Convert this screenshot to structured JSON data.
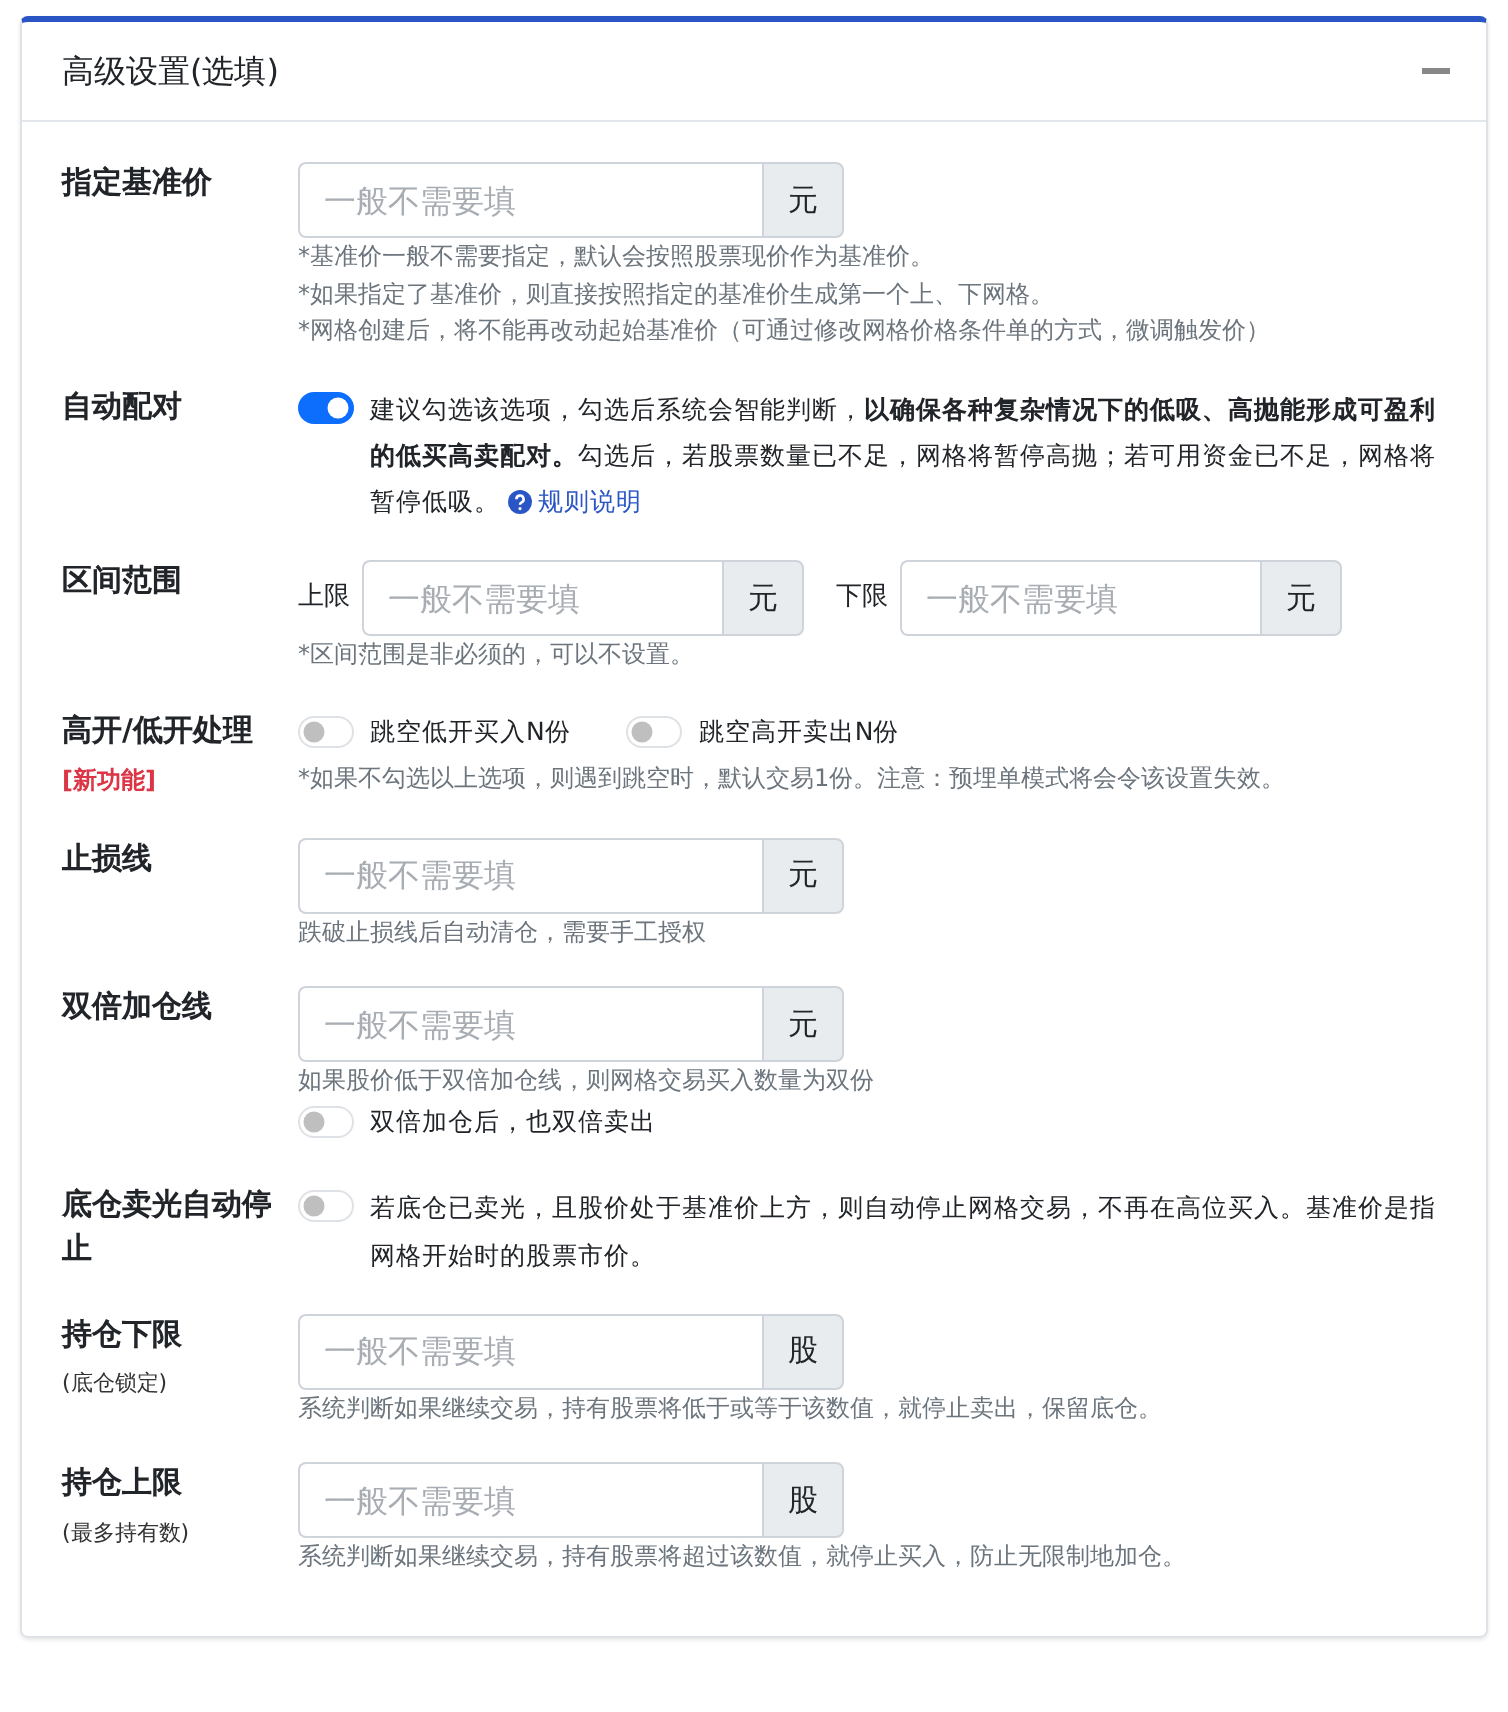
{
  "card": {
    "title": "高级设置(选填)",
    "expanded": true
  },
  "rows": [
    {
      "label": "指定基准价",
      "items": [
        {
          "kind": "inputs",
          "fields": [
            {
              "placeholder": "一般不需要填",
              "unit": "元"
            }
          ]
        },
        {
          "kind": "hint",
          "text": "*基准价一般不需要指定，默认会按照股票现价作为基准价。"
        },
        {
          "kind": "hint",
          "text": "*如果指定了基准价，则直接按照指定的基准价生成第一个上、下网格。"
        },
        {
          "kind": "hint",
          "text": "*网格创建后，将不能再改动起始基准价（可通过修改网格价格条件单的方式，微调触发价）"
        }
      ]
    },
    {
      "label": "自动配对",
      "items": [
        {
          "kind": "toggle-note",
          "on": true,
          "text": "建议勾选该选项，勾选后系统会智能判断，**以确保各种复杂情况下的低吸、高抛能形成可盈利的低买高卖配对。**勾选后，若股票数量已不足，网格将暂停高抛；若可用资金已不足，网格将暂停低吸。",
          "link": "规则说明"
        }
      ]
    },
    {
      "label": "区间范围",
      "items": [
        {
          "kind": "inputs",
          "fields": [
            {
              "prefix": "上限",
              "placeholder": "一般不需要填",
              "unit": "元"
            },
            {
              "prefix": "下限",
              "placeholder": "一般不需要填",
              "unit": "元"
            }
          ]
        },
        {
          "kind": "hint",
          "text": "*区间范围是非必须的，可以不设置。"
        }
      ]
    },
    {
      "label": "高开/低开处理",
      "note": {
        "text": "[新功能]",
        "kind": "alert"
      },
      "items": [
        {
          "kind": "toggles",
          "toggles": [
            {
              "label": "跳空低开买入N份",
              "on": false
            },
            {
              "label": "跳空高开卖出N份",
              "on": false
            }
          ]
        },
        {
          "kind": "hint",
          "text": "*如果不勾选以上选项，则遇到跳空时，默认交易1份。注意：预埋单模式将会令该设置失效。"
        }
      ]
    },
    {
      "label": "止损线",
      "items": [
        {
          "kind": "inputs",
          "fields": [
            {
              "placeholder": "一般不需要填",
              "unit": "元"
            }
          ]
        },
        {
          "kind": "hint",
          "text": "跌破止损线后自动清仓，需要手工授权"
        }
      ]
    },
    {
      "label": "双倍加仓线",
      "items": [
        {
          "kind": "inputs",
          "fields": [
            {
              "placeholder": "一般不需要填",
              "unit": "元"
            }
          ]
        },
        {
          "kind": "hint",
          "text": "如果股价低于双倍加仓线，则网格交易买入数量为双份"
        },
        {
          "kind": "toggles",
          "toggles": [
            {
              "label": "双倍加仓后，也双倍卖出",
              "on": false
            }
          ]
        }
      ]
    },
    {
      "label": "底仓卖光自动停止",
      "items": [
        {
          "kind": "toggle-note",
          "on": false,
          "text": "若底仓已卖光，且股价处于基准价上方，则自动停止网格交易，不再在高位买入。基准价是指网格开始时的股票市价。"
        }
      ]
    },
    {
      "label": "持仓下限",
      "note": {
        "text": "(底仓锁定)",
        "kind": "plain"
      },
      "items": [
        {
          "kind": "inputs",
          "fields": [
            {
              "placeholder": "一般不需要填",
              "unit": "股"
            }
          ]
        },
        {
          "kind": "hint",
          "text": "系统判断如果继续交易，持有股票将低于或等于该数值，就停止卖出，保留底仓。"
        }
      ]
    },
    {
      "label": "持仓上限",
      "note": {
        "text": "(最多持有数)",
        "kind": "plain"
      },
      "items": [
        {
          "kind": "inputs",
          "fields": [
            {
              "placeholder": "一般不需要填",
              "unit": "股"
            }
          ]
        },
        {
          "kind": "hint",
          "text": "系统判断如果继续交易，持有股票将超过该数值，就停止买入，防止无限制地加仓。"
        }
      ]
    }
  ]
}
